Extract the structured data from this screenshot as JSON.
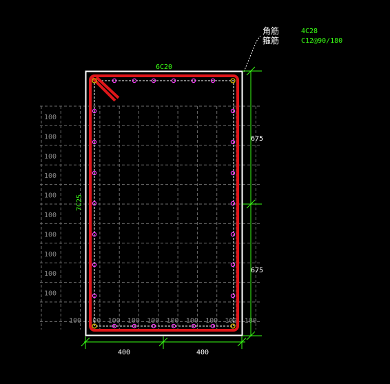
{
  "legend": {
    "corner_label": "角筋",
    "corner_value": "4C28",
    "stirrup_label": "箍筋",
    "stirrup_value": "C12@90/180"
  },
  "section": {
    "top_bar_label": "6C20",
    "side_bar_label": "7C25",
    "dim_right_upper": "675",
    "dim_right_lower": "675",
    "dim_bottom_left": "400",
    "dim_bottom_right": "400"
  },
  "grid": {
    "row_labels": [
      "100",
      "100",
      "100",
      "100",
      "100",
      "100",
      "100",
      "100",
      "100",
      "100"
    ],
    "col_labels": [
      "100",
      "100",
      "100",
      "100",
      "100",
      "100",
      "100",
      "100",
      "100",
      "100"
    ]
  },
  "colors": {
    "background": "#000000",
    "outline": "#ffffff",
    "stirrup": "#e0161a",
    "bar": "#ff3cff",
    "corner_bar": "#d6b400",
    "dimension": "#39ff14",
    "grid": "#6e6e6e"
  }
}
